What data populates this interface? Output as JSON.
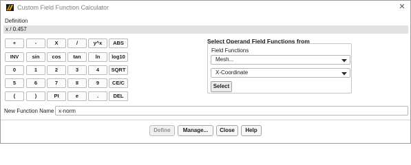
{
  "window": {
    "title": "Custom Field Function Calculator",
    "close_label": "✕"
  },
  "definition": {
    "label": "Definition",
    "value": "x / 0.457"
  },
  "keypad": {
    "rows": [
      [
        "+",
        "-",
        "X",
        "/",
        "y^x",
        "ABS"
      ],
      [
        "INV",
        "sin",
        "cos",
        "tan",
        "ln",
        "log10"
      ],
      [
        "0",
        "1",
        "2",
        "3",
        "4",
        "SQRT"
      ],
      [
        "5",
        "6",
        "7",
        "8",
        "9",
        "CE/C"
      ],
      [
        "(",
        ")",
        "PI",
        "e",
        ".",
        "DEL"
      ]
    ]
  },
  "operand": {
    "title": "Select Operand Field Functions from",
    "field_functions_label": "Field Functions",
    "category_selected": "Mesh...",
    "function_selected": "X-Coordinate",
    "select_label": "Select"
  },
  "new_function": {
    "label": "New Function Name",
    "value": "x-norm"
  },
  "buttons": {
    "define": "Define",
    "manage": "Manage...",
    "close": "Close",
    "help": "Help"
  }
}
